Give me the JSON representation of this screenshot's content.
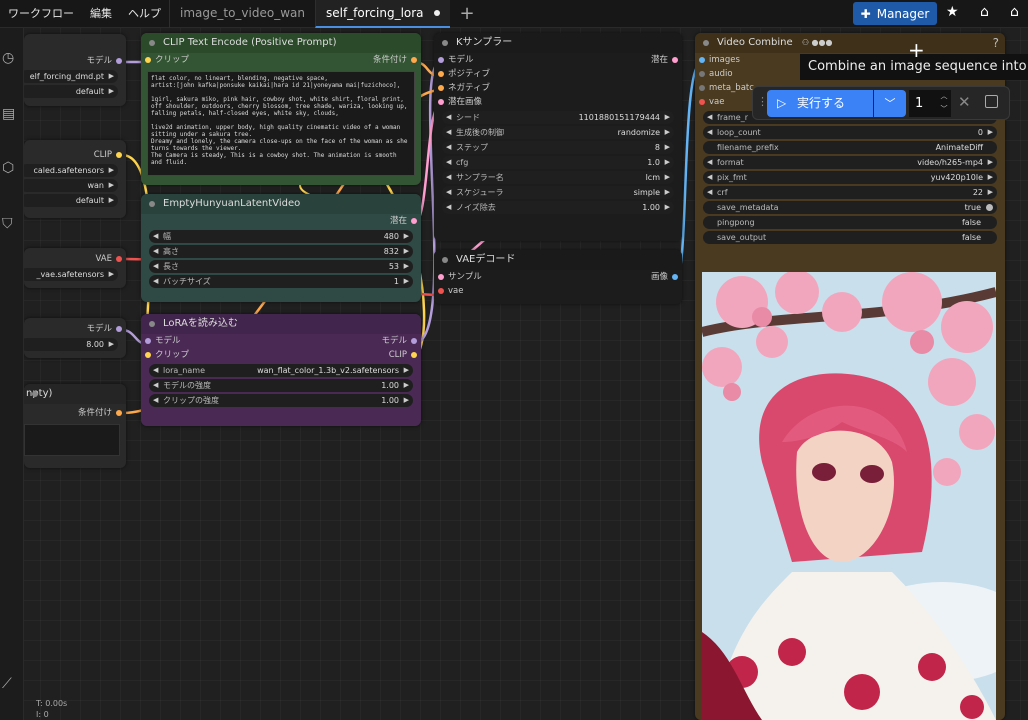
{
  "menu": [
    "ワークフロー",
    "編集",
    "ヘルプ"
  ],
  "tabs": [
    {
      "label": "image_to_video_wan",
      "active": false
    },
    {
      "label": "self_forcing_lora",
      "active": true
    }
  ],
  "topbar": {
    "manager_label": "Manager"
  },
  "left_partial": {
    "model_label": "モデル",
    "model_file": "elf_forcing_dmd.pt",
    "model_dtype": "default",
    "clip_label": "CLIP",
    "clip_file": "caled.safetensors",
    "clip_type": "wan",
    "clip_device": "default",
    "vae_label": "VAE",
    "vae_file": "_vae.safetensors",
    "shift_label": "モデル",
    "shift_value": "8.00",
    "neg_title": "npty)",
    "neg_out": "条件付け"
  },
  "clip_encode": {
    "title": "CLIP Text Encode (Positive Prompt)",
    "in": "クリップ",
    "out": "条件付け",
    "text": "flat color, no lineart, blending, negative space,\nartist:[john kafka|ponsuke kaikai|hara id 21|yoneyama mai|fuzichoco],\n\n1girl, sakura miko, pink hair, cowboy shot, white shirt, floral print, off shoulder, outdoors, cherry blossom, tree shade, wariza, looking up, falling petals, half-closed eyes, white sky, clouds,\n\nlive2d animation, upper body, high quality cinematic video of a woman sitting under a sakura tree.\nDreamy and lonely, the camera close-ups on the face of the woman as she turns towards the viewer.\nThe Camera is steady, This is a cowboy shot. The animation is smooth and fluid."
  },
  "latent": {
    "title": "EmptyHunyuanLatentVideo",
    "out": "潜在",
    "widgets": [
      {
        "label": "幅",
        "value": "480"
      },
      {
        "label": "高さ",
        "value": "832"
      },
      {
        "label": "長さ",
        "value": "53"
      },
      {
        "label": "バッチサイズ",
        "value": "1"
      }
    ]
  },
  "lora": {
    "title": "LoRAを読み込む",
    "in_model": "モデル",
    "in_clip": "クリップ",
    "out_model": "モデル",
    "out_clip": "CLIP",
    "widgets": [
      {
        "label": "lora_name",
        "value": "wan_flat_color_1.3b_v2.safetensors"
      },
      {
        "label": "モデルの強度",
        "value": "1.00"
      },
      {
        "label": "クリップの強度",
        "value": "1.00"
      }
    ]
  },
  "ksampler": {
    "title": "Kサンプラー",
    "inputs": [
      "モデル",
      "ポジティブ",
      "ネガティブ",
      "潜在画像"
    ],
    "out": "潜在",
    "widgets": [
      {
        "label": "シード",
        "value": "1101880151179444"
      },
      {
        "label": "生成後の制御",
        "value": "randomize"
      },
      {
        "label": "ステップ",
        "value": "8"
      },
      {
        "label": "cfg",
        "value": "1.0"
      },
      {
        "label": "サンプラー名",
        "value": "lcm"
      },
      {
        "label": "スケジューラ",
        "value": "simple"
      },
      {
        "label": "ノイズ除去",
        "value": "1.00"
      }
    ]
  },
  "vae_decode": {
    "title": "VAEデコード",
    "in_samples": "サンプル",
    "in_vae": "vae",
    "out": "画像"
  },
  "video_combine": {
    "title": "Video Combine",
    "inputs": [
      "images",
      "audio",
      "meta_batc",
      "vae"
    ],
    "widgets": [
      {
        "label": "frame_r",
        "value": ""
      },
      {
        "label": "loop_count",
        "value": "0"
      },
      {
        "label": "filename_prefix",
        "value": "AnimateDiff"
      },
      {
        "label": "format",
        "value": "video/h265-mp4"
      },
      {
        "label": "pix_fmt",
        "value": "yuv420p10le"
      },
      {
        "label": "crf",
        "value": "22"
      },
      {
        "label": "save_metadata",
        "value": "true"
      },
      {
        "label": "pingpong",
        "value": "false"
      },
      {
        "label": "save_output",
        "value": "false"
      }
    ]
  },
  "runbar": {
    "run_label": "実行する",
    "count": "1"
  },
  "tooltip": "Combine an image sequence into a",
  "stats": {
    "t": "T: 0.00s",
    "i": "I: 0"
  },
  "colors": {
    "accent": "#3b82f6",
    "clip_node": "#335533",
    "latent_node": "#2f4a44",
    "lora_node": "#4a2a55",
    "video_node": "#4a3a20"
  }
}
